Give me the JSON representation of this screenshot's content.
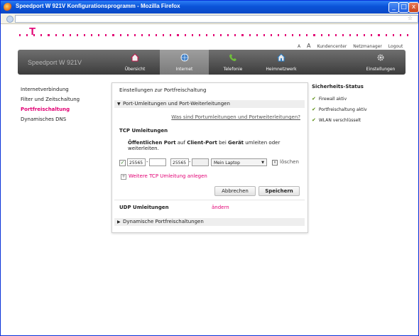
{
  "window": {
    "title": "Speedport W 921V Konfigurationsprogramm - Mozilla Firefox"
  },
  "window_buttons": {
    "minimize": "_",
    "maximize": "□",
    "close": "x"
  },
  "top_links": {
    "font_small": "A",
    "font_large": "A",
    "kundencenter": "Kundencenter",
    "netzmanager": "Netzmanager",
    "logout": "Logout"
  },
  "brand": {
    "name": "Speedport W 921V",
    "logo_letter": "T"
  },
  "nav": [
    {
      "label": "Übersicht",
      "icon": "house-icon"
    },
    {
      "label": "Internet",
      "icon": "globe-icon"
    },
    {
      "label": "Telefonie",
      "icon": "phone-icon"
    },
    {
      "label": "Heimnetzwerk",
      "icon": "network-house-icon"
    },
    {
      "label": "Einstellungen",
      "icon": "gear-icon"
    }
  ],
  "sidebar": {
    "items": [
      {
        "label": "Internetverbindung"
      },
      {
        "label": "Filter und Zeitschaltung"
      },
      {
        "label": "Portfreischaltung"
      },
      {
        "label": "Dynamisches DNS"
      }
    ]
  },
  "panel": {
    "heading": "Einstellungen zur Portfreischaltung",
    "section1": "Port-Umleitungen und Port-Weiterleitungen",
    "section1_arrow": "▼",
    "hint_link": "Was sind Portumleitungen und Portweiterleitungen?",
    "tcp_title": "TCP Umleitungen",
    "desc": {
      "p1": "Öffentlichen Port",
      "p2": " auf ",
      "p3": "Client-Port",
      "p4": " bei ",
      "p5": "Gerät",
      "p6": " umleiten oder weiterleiten."
    },
    "rule": {
      "checked_mark": "✓",
      "public_from": "25565",
      "public_to": "",
      "client_from": "25565",
      "client_to": "",
      "separator": "-",
      "device": "Mein Laptop",
      "dropdown_caret": "▼",
      "delete_box": "x",
      "delete_label": "löschen"
    },
    "add_more_icon": "+",
    "add_more": "Weitere TCP Umleitung anlegen",
    "cancel": "Abbrechen",
    "save": "Speichern",
    "udp_title": "UDP Umleitungen",
    "udp_change": "ändern",
    "section2": "Dynamische Portfreischaltungen",
    "section2_arrow": "▶"
  },
  "status": {
    "title": "Sicherheits-Status",
    "check_mark": "✔",
    "items": [
      {
        "label": "Firewall aktiv"
      },
      {
        "label": "Portfreischaltung aktiv"
      },
      {
        "label": "WLAN verschlüsselt"
      }
    ]
  },
  "colors": {
    "accent": "#e20074",
    "nav_dark": "#4a4a4a",
    "check_green": "#5a8f12"
  }
}
